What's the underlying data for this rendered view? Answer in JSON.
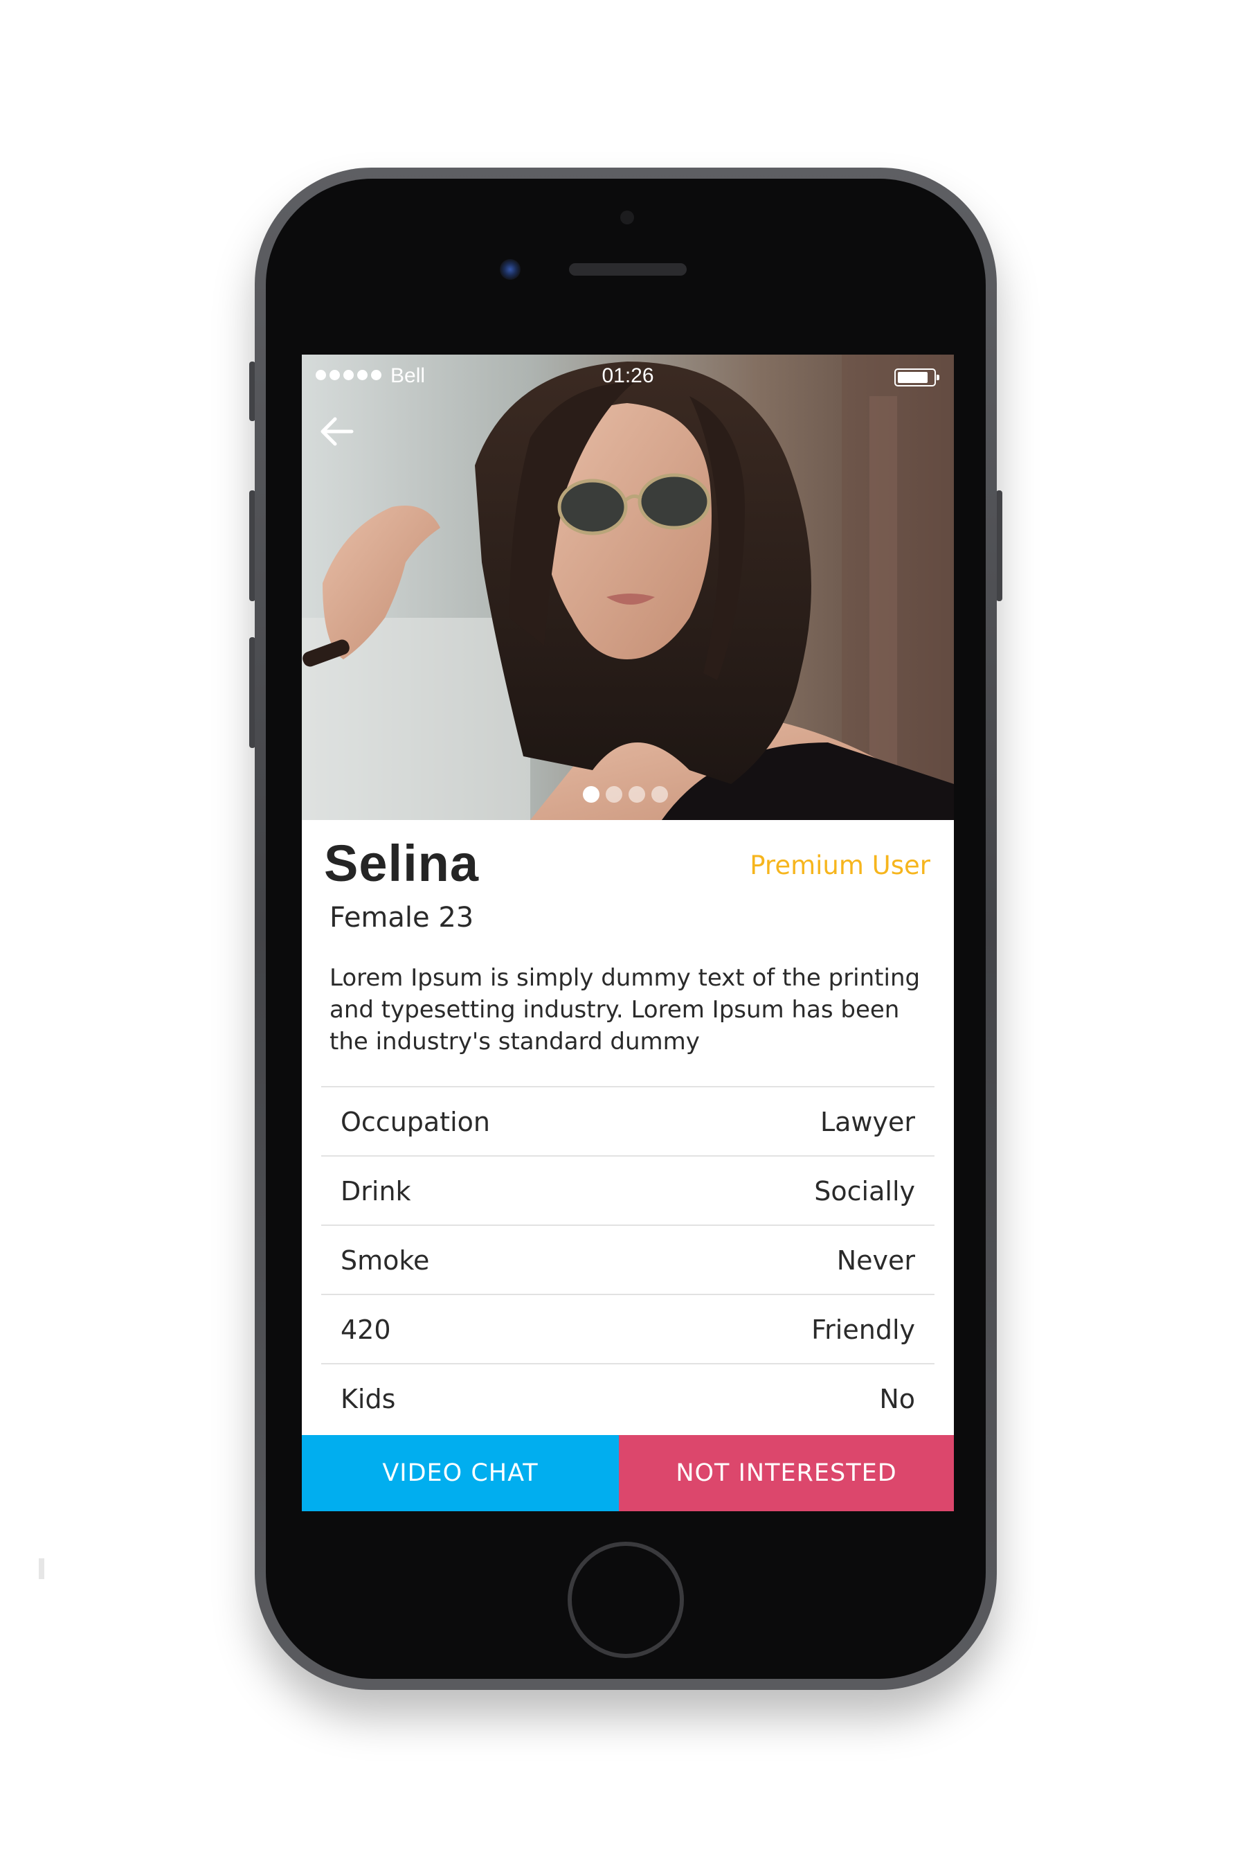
{
  "status_bar": {
    "carrier": "Bell",
    "time": "01:26",
    "battery_level": 0.8
  },
  "gallery": {
    "photo_count": 4,
    "active_index": 0
  },
  "profile": {
    "name": "Selina",
    "badge": "Premium User",
    "subtitle": "Female 23",
    "bio": "Lorem Ipsum is simply dummy text of the printing and typesetting industry. Lorem Ipsum has been the industry's standard dummy"
  },
  "details": [
    {
      "label": "Occupation",
      "value": "Lawyer"
    },
    {
      "label": "Drink",
      "value": "Socially"
    },
    {
      "label": "Smoke",
      "value": "Never"
    },
    {
      "label": "420",
      "value": "Friendly"
    },
    {
      "label": "Kids",
      "value": "No"
    }
  ],
  "actions": {
    "video_chat": "VIDEO CHAT",
    "not_interested": "NOT INTERESTED"
  },
  "colors": {
    "accent_premium": "#f6b51d",
    "video_chat": "#01aeef",
    "not_interested": "#dc476c"
  },
  "icons": {
    "back": "arrow-left-icon"
  }
}
